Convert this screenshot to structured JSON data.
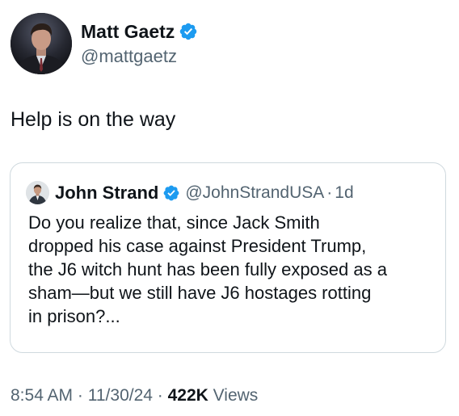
{
  "author": {
    "name": "Matt Gaetz",
    "handle": "@mattgaetz",
    "verified_icon": "verified-badge-icon",
    "verified_color": "#1d9bf0"
  },
  "tweet": {
    "text": "Help is on the way"
  },
  "quoted_tweet": {
    "name": "John Strand",
    "handle": "@JohnStrandUSA",
    "separator": "·",
    "time": "1d",
    "lines": [
      "Do you realize that, since Jack Smith",
      "dropped his case against President Trump,",
      "the J6 witch hunt has been fully exposed as a",
      "sham—but we still have J6 hostages rotting",
      "in prison?..."
    ]
  },
  "meta": {
    "time": "8:54 AM",
    "sep1": "·",
    "date": "11/30/24",
    "sep2": "·",
    "views_count": "422K",
    "views_label": "Views"
  },
  "colors": {
    "text_primary": "#0f1419",
    "text_secondary": "#536471",
    "border": "#cfd9de"
  }
}
